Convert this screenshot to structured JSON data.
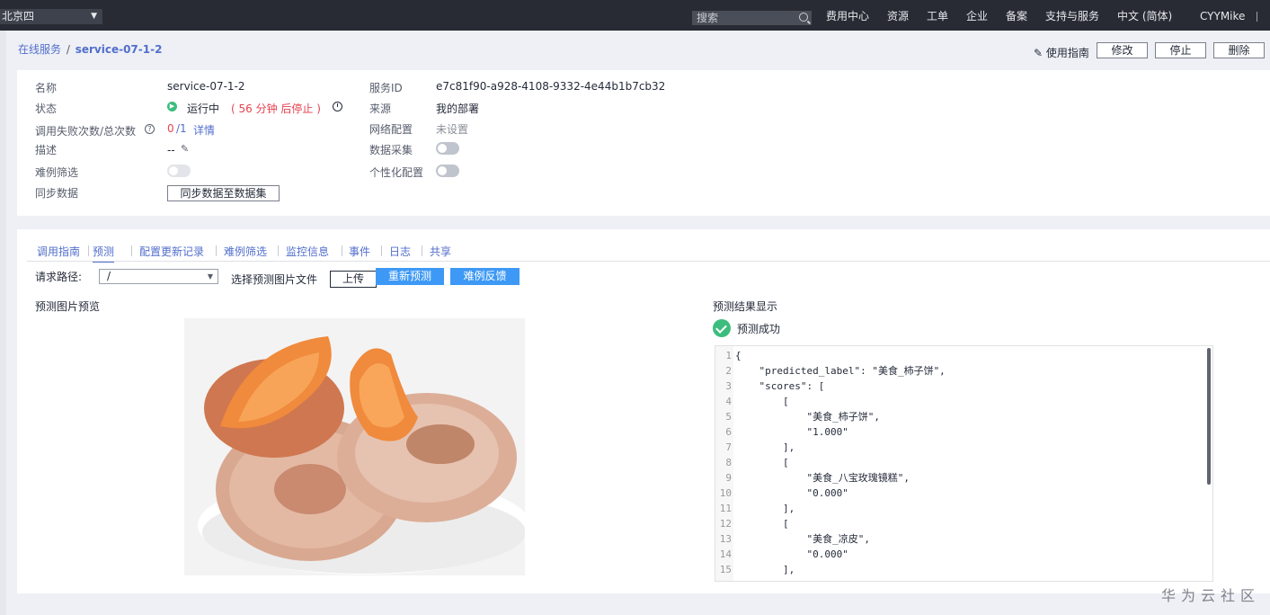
{
  "topbar": {
    "region": "北京四",
    "search_placeholder": "搜索",
    "nav": [
      "费用中心",
      "资源",
      "工单",
      "企业",
      "备案",
      "支持与服务",
      "中文 (简体)",
      "CYYMike"
    ]
  },
  "breadcrumb": {
    "parent": "在线服务",
    "separator": "/",
    "current": "service-07-1-2"
  },
  "header_actions": {
    "guide": "使用指南",
    "edit": "修改",
    "stop": "停止",
    "delete": "删除"
  },
  "info": {
    "name_label": "名称",
    "name_value": "service-07-1-2",
    "status_label": "状态",
    "status_value": "运行中",
    "status_note": "( 56 分钟 后停止 )",
    "fail_label": "调用失败次数/总次数",
    "fail_count": "0",
    "total_count": "/1",
    "detail_link": "详情",
    "desc_label": "描述",
    "desc_value": "--",
    "hard_label": "难例筛选",
    "sync_label": "同步数据",
    "sync_button": "同步数据至数据集",
    "service_id_label": "服务ID",
    "service_id_value": "e7c81f90-a928-4108-9332-4e44b1b7cb32",
    "source_label": "来源",
    "source_value": "我的部署",
    "network_label": "网络配置",
    "network_value": "未设置",
    "collect_label": "数据采集",
    "personal_label": "个性化配置"
  },
  "tabs": [
    "调用指南",
    "预测",
    "配置更新记录",
    "难例筛选",
    "监控信息",
    "事件",
    "日志",
    "共享"
  ],
  "active_tab": "预测",
  "predict": {
    "path_label": "请求路径:",
    "path_value": "/",
    "file_label": "选择预测图片文件",
    "upload_button": "上传",
    "repredict_button": "重新预测",
    "feedback_button": "难例反馈",
    "preview_title": "预测图片预览",
    "result_title": "预测结果显示",
    "success_text": "预测成功"
  },
  "code_lines": [
    {
      "n": "1",
      "t": "{"
    },
    {
      "n": "2",
      "t": "    \"predicted_label\": \"美食_柿子饼\","
    },
    {
      "n": "3",
      "t": "    \"scores\": ["
    },
    {
      "n": "4",
      "t": "        ["
    },
    {
      "n": "5",
      "t": "            \"美食_柿子饼\","
    },
    {
      "n": "6",
      "t": "            \"1.000\""
    },
    {
      "n": "7",
      "t": "        ],"
    },
    {
      "n": "8",
      "t": "        ["
    },
    {
      "n": "9",
      "t": "            \"美食_八宝玫瑰镜糕\","
    },
    {
      "n": "10",
      "t": "            \"0.000\""
    },
    {
      "n": "11",
      "t": "        ],"
    },
    {
      "n": "12",
      "t": "        ["
    },
    {
      "n": "13",
      "t": "            \"美食_凉皮\","
    },
    {
      "n": "14",
      "t": "            \"0.000\""
    },
    {
      "n": "15",
      "t": "        ],"
    }
  ],
  "watermark": "华为云社区",
  "colors": {
    "link": "#526ecc",
    "primary": "#3d99f5",
    "success": "#3dbd7d",
    "danger": "#e6424f"
  }
}
